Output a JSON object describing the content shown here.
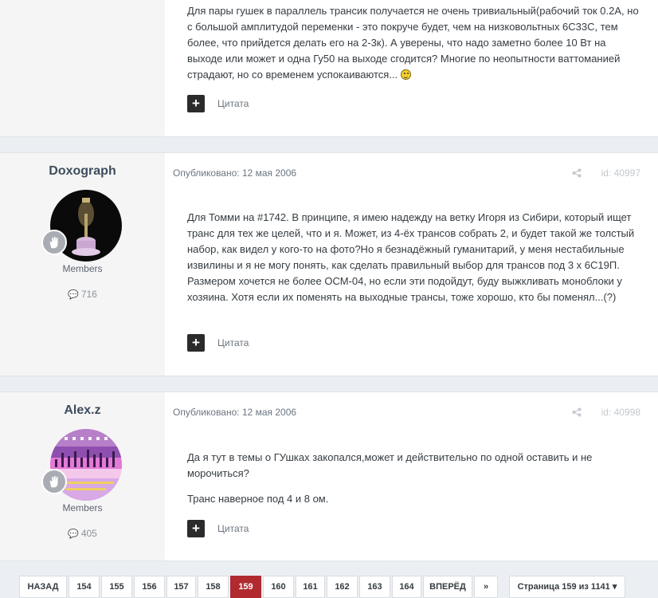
{
  "posts": [
    {
      "body": [
        "Для пары гушек в параллель трансик получается не очень тривиальный(рабочий ток 0.2А, но с большой амплитудой переменки - это покруче будет, чем на низковольтных 6С33С, тем более, что прийдется делать его на 2-3к). А уверены, что надо заметно более 10 Вт на выходе или может и одна Гу50 на выходе сгодится? Многие по неопытности ваттоманией страдают, но со временем успокаиваются..."
      ],
      "quote_label": "Цитата"
    },
    {
      "author": "Doxograph",
      "group": "Members",
      "post_count": "716",
      "published": "Опубликовано: 12 мая 2006",
      "post_id": "id: 40997",
      "body": [
        "Для Томми на #1742. В принципе, я имею надежду на ветку Игоря из Сибири, который ищет транс для тех же целей, что и я. Может, из 4-ёх трансов собрать 2, и будет такой же толстый набор, как видел у кого-то на фото?Но я безнадёжный гуманитарий, у меня нестабильные извилины и я не могу понять, как сделать правильный выбор для трансов под 3 х 6С19П. Размером хочется не более ОСМ-04, но если эти подойдут, буду выжкливать моноблоки у хозяина. Хотя если их поменять на выходные трансы, тоже хорошо, кто бы поменял...(?)"
      ],
      "quote_label": "Цитата"
    },
    {
      "author": "Alex.z",
      "group": "Members",
      "post_count": "405",
      "published": "Опубликовано: 12 мая 2006",
      "post_id": "id: 40998",
      "body": [
        "Да я тут в темы о ГУшках закопался,может и действительно по одной оставить и не морочиться?",
        "Транс наверное под 4 и 8 ом."
      ],
      "quote_label": "Цитата"
    }
  ],
  "pagination": {
    "prev_label": "НАЗАД",
    "pages": [
      "154",
      "155",
      "156",
      "157",
      "158",
      "159",
      "160",
      "161",
      "162",
      "163",
      "164"
    ],
    "active_page": "159",
    "next_label": "ВПЕРЁД",
    "last_label": "»",
    "page_info": "Страница 159 из 1141",
    "dropdown_arrow": "▾"
  },
  "icons": {
    "plus": "+",
    "comment": "comment-icon",
    "share": "share-icon",
    "rank": "hand-icon",
    "smiley": "smiley-icon"
  },
  "colors": {
    "active_page": "#b02a30",
    "author_name": "#3d4d5e"
  }
}
